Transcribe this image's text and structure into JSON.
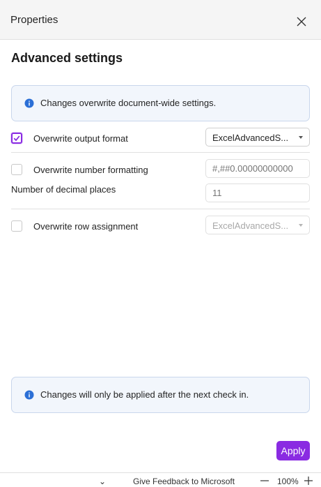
{
  "header": {
    "title": "Properties"
  },
  "section": {
    "title": "Advanced settings"
  },
  "info_top": {
    "text": "Changes overwrite document-wide settings."
  },
  "settings": {
    "output_format": {
      "label": "Overwrite output format",
      "checked": true,
      "value": "ExcelAdvancedS..."
    },
    "number_formatting": {
      "label": "Overwrite number formatting",
      "checked": false,
      "placeholder": "#,##0.00000000000"
    },
    "decimal_places": {
      "label": "Number of decimal places",
      "placeholder": "11"
    },
    "row_assignment": {
      "label": "Overwrite row assignment",
      "checked": false,
      "value": "ExcelAdvancedS..."
    }
  },
  "info_bottom": {
    "text": "Changes will only be applied after the next check in."
  },
  "footer": {
    "apply_label": "Apply"
  },
  "statusbar": {
    "chevron": "⌄",
    "feedback": "Give Feedback to Microsoft",
    "zoom": "100%"
  },
  "colors": {
    "accent": "#8a2be2",
    "info_icon": "#2b6fd6",
    "info_bg": "#f2f6fc"
  }
}
